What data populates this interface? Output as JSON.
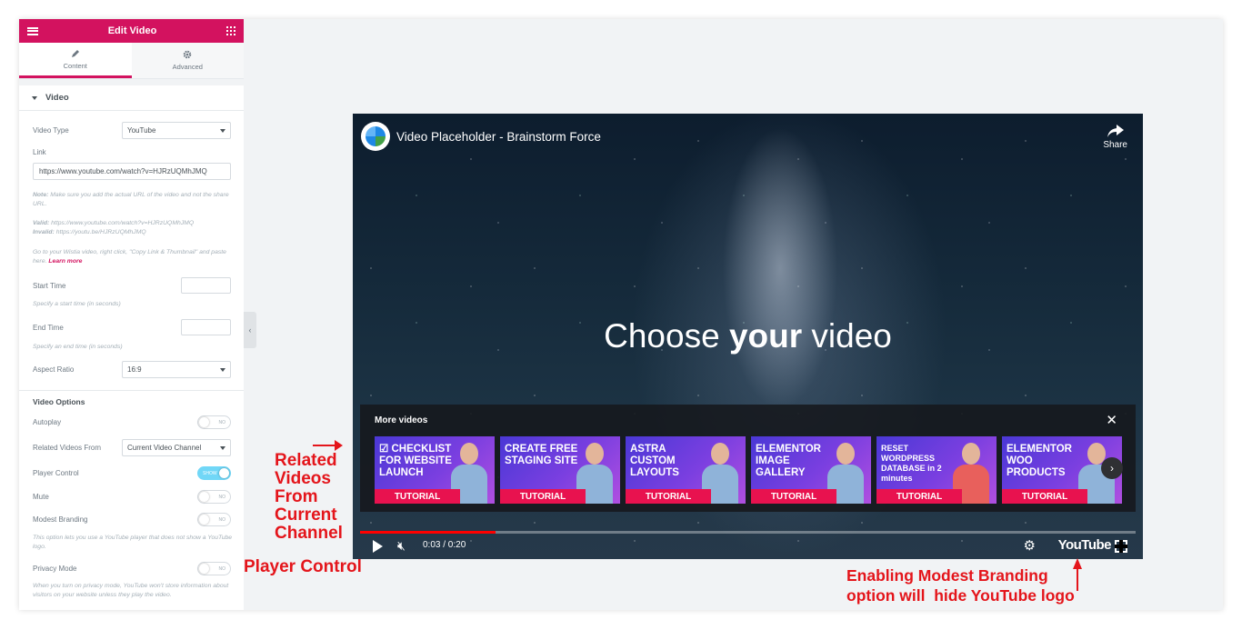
{
  "panel": {
    "title": "Edit Video",
    "tabs": [
      {
        "label": "Content"
      },
      {
        "label": "Advanced"
      }
    ],
    "section": "Video",
    "video_type": {
      "label": "Video Type",
      "value": "YouTube"
    },
    "link": {
      "label": "Link",
      "value": "https://www.youtube.com/watch?v=HJRzUQMhJMQ"
    },
    "notes": {
      "note_label": "Note:",
      "note_text": "Make sure you add the actual URL of the video and not the share URL.",
      "valid_label": "Valid:",
      "valid_text": "https://www.youtube.com/watch?v=HJRzUQMhJMQ",
      "invalid_label": "Invalid:",
      "invalid_text": "https://youtu.be/HJRzUQMhJMQ",
      "wistia_text": "Go to your Wistia video, right click, \"Copy Link & Thumbnail\" and paste here.",
      "learn_more": "Learn more"
    },
    "start_time": {
      "label": "Start Time",
      "hint": "Specify a start time (in seconds)"
    },
    "end_time": {
      "label": "End Time",
      "hint": "Specify an end time (in seconds)"
    },
    "aspect_ratio": {
      "label": "Aspect Ratio",
      "value": "16:9"
    },
    "video_options_title": "Video Options",
    "autoplay": {
      "label": "Autoplay",
      "state": "NO"
    },
    "related_videos": {
      "label": "Related Videos From",
      "value": "Current Video Channel"
    },
    "player_control": {
      "label": "Player Control",
      "state": "SHOW"
    },
    "mute": {
      "label": "Mute",
      "state": "NO"
    },
    "modest_branding": {
      "label": "Modest Branding",
      "state": "NO",
      "hint": "This option lets you use a YouTube player that does not show a YouTube logo."
    },
    "privacy_mode": {
      "label": "Privacy Mode",
      "state": "NO",
      "hint": "When you turn on privacy mode, YouTube won't store information about visitors on your website unless they play the video."
    }
  },
  "video": {
    "title": "Video Placeholder - Brainstorm Force",
    "share": "Share",
    "headline_pre": "Choose ",
    "headline_bold": "your",
    "headline_post": " video",
    "more_videos": "More videos",
    "thumbnails": [
      {
        "text": "☑ CHECKLIST FOR WEBSITE LAUNCH",
        "badge": "TUTORIAL"
      },
      {
        "text": "CREATE FREE STAGING SITE",
        "badge": "TUTORIAL"
      },
      {
        "text": "ASTRA CUSTOM LAYOUTS",
        "badge": "TUTORIAL"
      },
      {
        "text": "ELEMENTOR IMAGE GALLERY",
        "badge": "TUTORIAL"
      },
      {
        "text": "RESET WORDPRESS DATABASE in 2 minutes",
        "badge": "TUTORIAL"
      },
      {
        "text": "ELEMENTOR WOO PRODUCTS",
        "badge": "TUTORIAL"
      }
    ],
    "time": "0:03 / 0:20",
    "progress": 0.175,
    "youtube_logo": "YouTube"
  },
  "annotations": {
    "related": [
      "Related",
      "Videos",
      "From",
      "Current",
      "Channel"
    ],
    "player_control": "Player Control",
    "branding": [
      "Enabling Modest Branding",
      "option will  hide YouTube logo"
    ]
  },
  "colors": {
    "accent": "#d3125f",
    "annotation": "#e4151b",
    "switch_on": "#71d7f7"
  }
}
